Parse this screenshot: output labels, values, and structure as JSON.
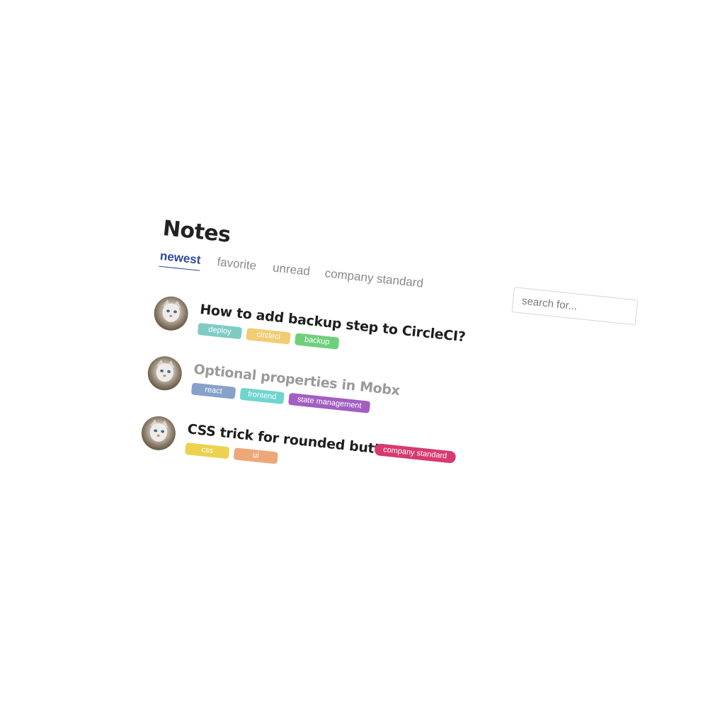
{
  "page": {
    "title": "Notes"
  },
  "tabs": [
    {
      "label": "newest",
      "active": true
    },
    {
      "label": "favorite",
      "active": false
    },
    {
      "label": "unread",
      "active": false
    },
    {
      "label": "company standard",
      "active": false
    }
  ],
  "search": {
    "placeholder": "search for...",
    "value": ""
  },
  "notes": [
    {
      "title": "How to add backup step to CircleCI?",
      "read": false,
      "tags": [
        {
          "label": "deploy",
          "color": "#7fcbc4"
        },
        {
          "label": "circleci",
          "color": "#f0cc72"
        },
        {
          "label": "backup",
          "color": "#6fd07c"
        }
      ]
    },
    {
      "title": "Optional properties in Mobx",
      "read": true,
      "tags": [
        {
          "label": "react",
          "color": "#86a2cc"
        },
        {
          "label": "frontend",
          "color": "#6fd4d0"
        },
        {
          "label": "state management",
          "color": "#a25ec2"
        }
      ]
    },
    {
      "title": "CSS trick for rounded buttons",
      "read": false,
      "badge": {
        "label": "company standard",
        "color": "#d63a6e"
      },
      "tags": [
        {
          "label": "css",
          "color": "#ecd24e"
        },
        {
          "label": "ui",
          "color": "#eda87a"
        }
      ]
    }
  ],
  "colors": {
    "accent": "#2d4a9a",
    "muted_text": "#8a8a8a",
    "title_text": "#222222"
  }
}
